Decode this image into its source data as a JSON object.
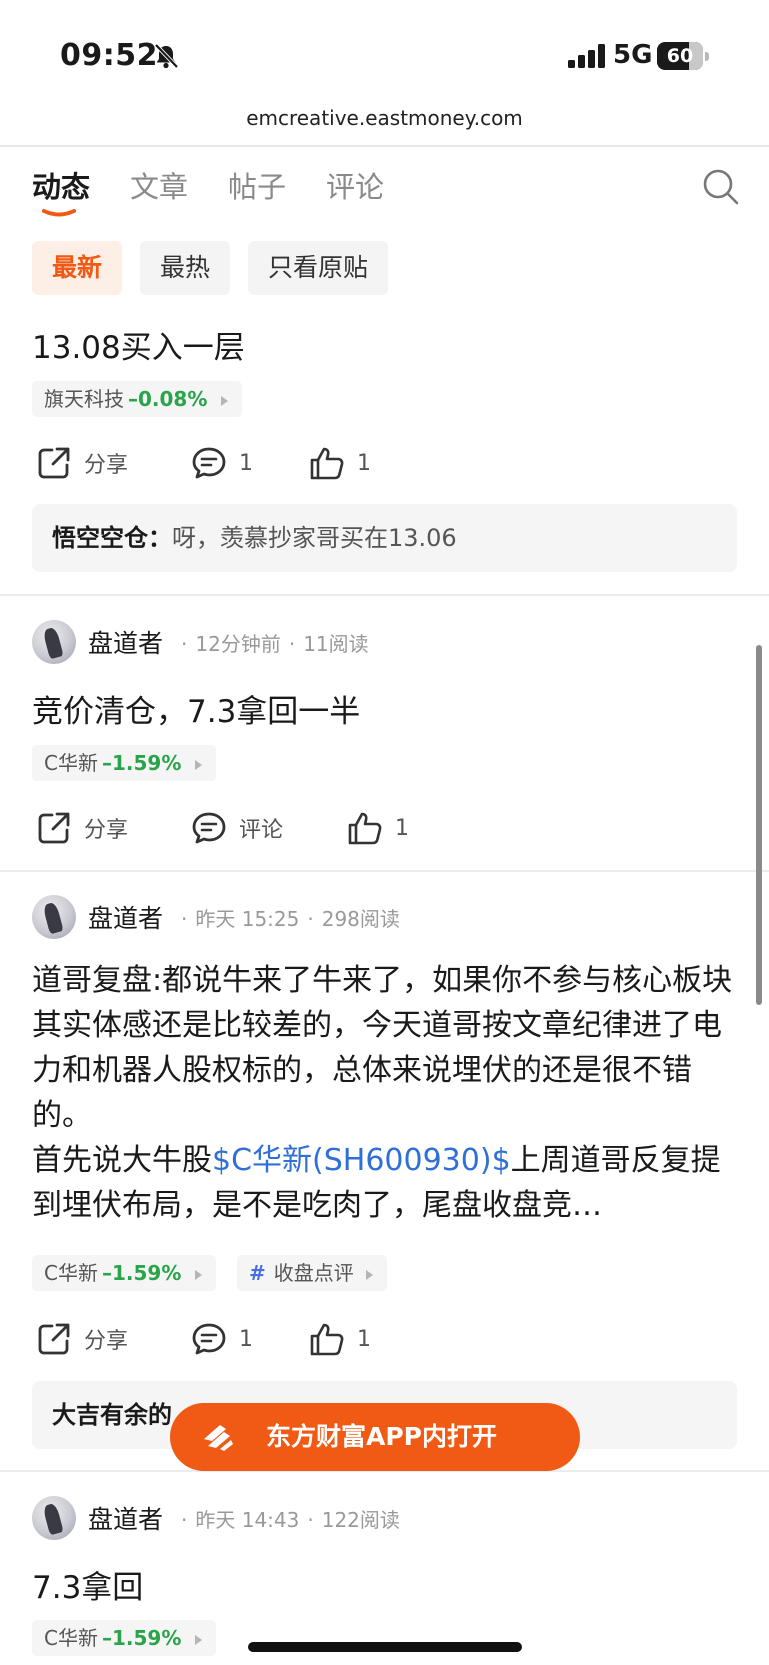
{
  "status_bar": {
    "time": "09:52",
    "network": "5G",
    "battery": "60"
  },
  "url": "emcreative.eastmoney.com",
  "tabs": [
    {
      "label": "动态"
    },
    {
      "label": "文章"
    },
    {
      "label": "帖子"
    },
    {
      "label": "评论"
    }
  ],
  "filters": [
    {
      "label": "最新"
    },
    {
      "label": "最热"
    },
    {
      "label": "只看原贴"
    }
  ],
  "post1": {
    "text": "13.08买入一层",
    "stock": {
      "name": "旗天科技",
      "change": "–0.08%"
    },
    "share_label": "分享",
    "comment_count": "1",
    "like_count": "1",
    "reply": {
      "author": "悟空空仓：",
      "text": "呀，羡慕抄家哥买在13.06"
    }
  },
  "post2": {
    "author": "盘道者",
    "time": "12分钟前",
    "reads": "11阅读",
    "text": "竞价清仓，7.3拿回一半",
    "stock": {
      "name": "C华新",
      "change": "–1.59%"
    },
    "share_label": "分享",
    "comment_label": "评论",
    "like_count": "1"
  },
  "post3": {
    "author": "盘道者",
    "time": "昨天 15:25",
    "reads": "298阅读",
    "text_a": "道哥复盘:都说牛来了牛来了，如果你不参与核心板块其实体感还是比较差的，今天道哥按文章纪律进了电力和机器人股权标的，总体来说埋伏的还是很不错的。",
    "text_b": "首先说大牛股",
    "text_link": "$C华新(SH600930)$",
    "text_c": "上周道哥反复提到埋伏布局，是不是吃肉了，尾盘收盘竞…",
    "stock": {
      "name": "C华新",
      "change": "–1.59%"
    },
    "topic": "收盘点评",
    "share_label": "分享",
    "comment_count": "1",
    "like_count": "1",
    "reply_author": "大吉有余的"
  },
  "post4": {
    "author": "盘道者",
    "time": "昨天 14:43",
    "reads": "122阅读",
    "text": "7.3拿回",
    "stock": {
      "name": "C华新",
      "change": "–1.59%"
    }
  },
  "open_app_label": "东方财富APP内打开",
  "colors": {
    "accent": "#f05a14",
    "down": "#2aa44a",
    "link": "#2f6fd8"
  }
}
